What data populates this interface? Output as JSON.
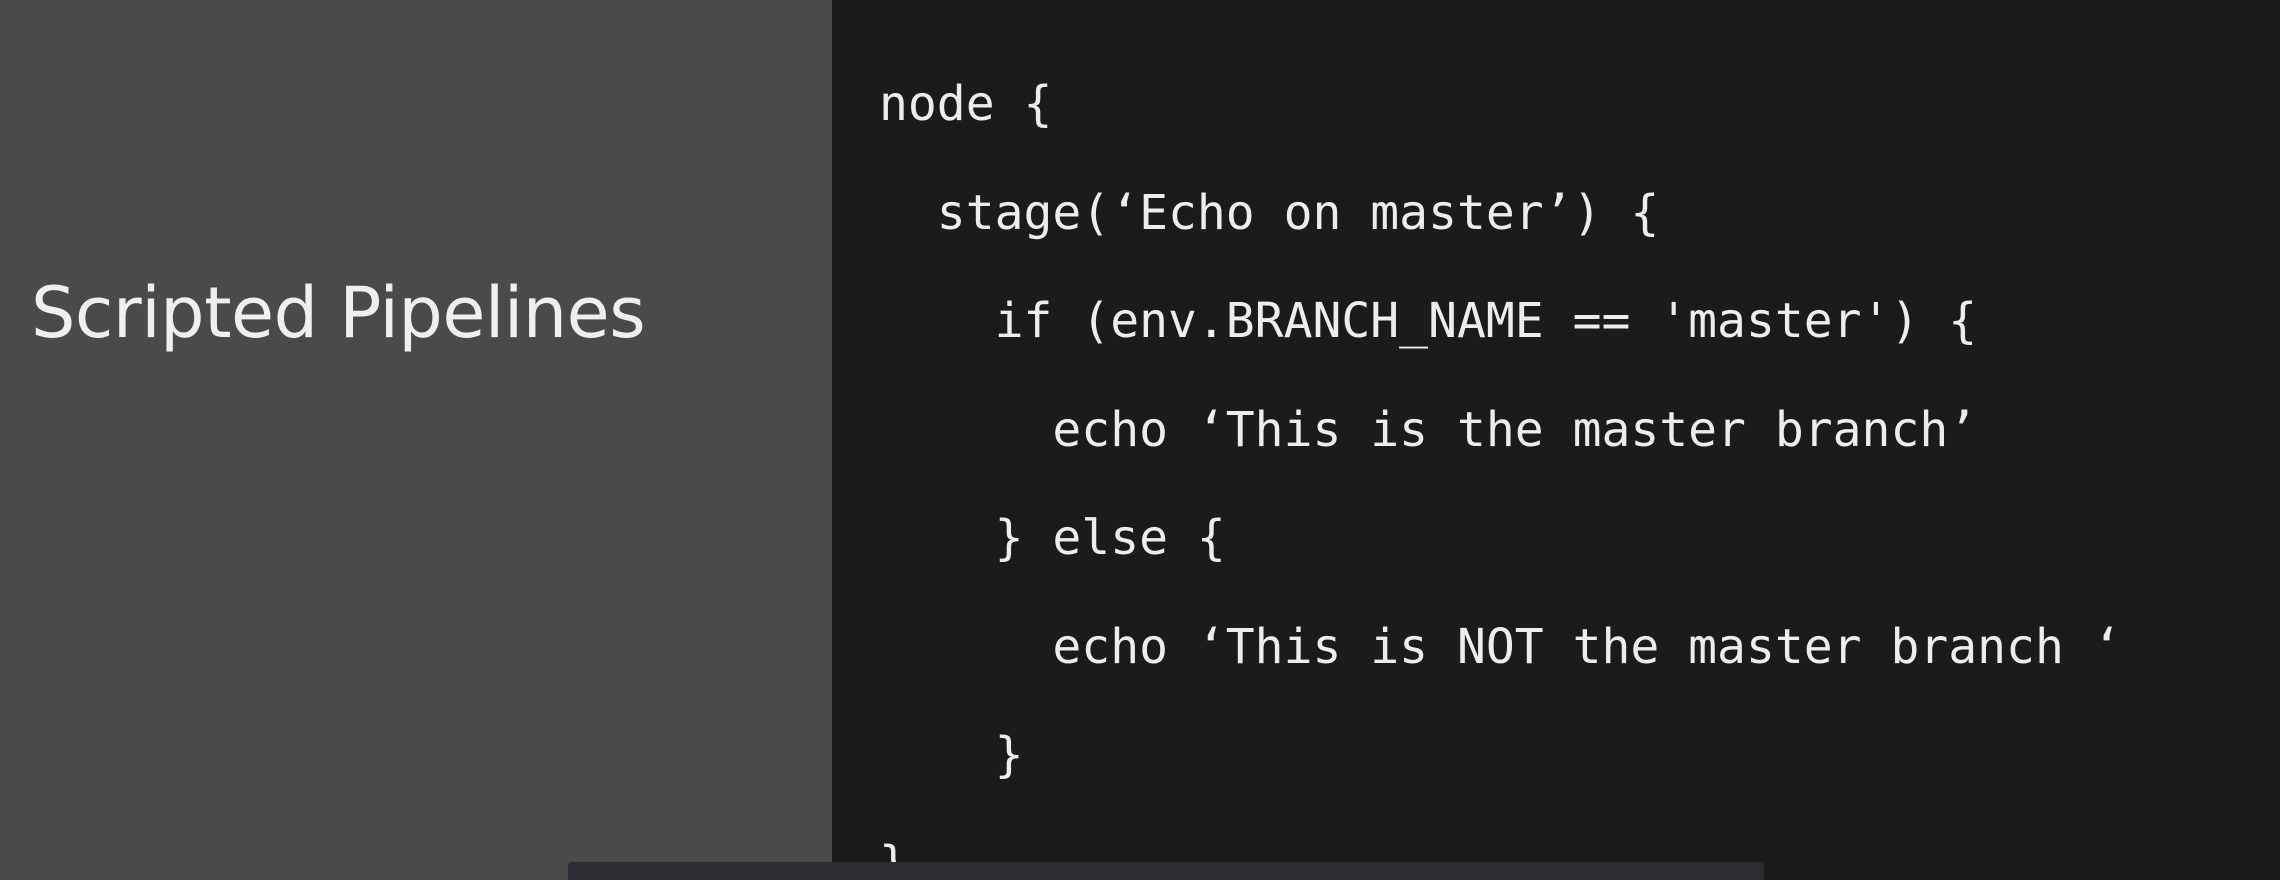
{
  "slide": {
    "title": "Scripted Pipelines"
  },
  "code": {
    "lines": [
      "node {",
      "  stage(‘Echo on master’) {",
      "    if (env.BRANCH_NAME == 'master') {",
      "      echo ‘This is the master branch’",
      "    } else {",
      "      echo ‘This is NOT the master branch ‘",
      "    }",
      "}"
    ]
  },
  "colors": {
    "left_panel_background": "#4a4a4a",
    "code_panel_background": "#1b1b1b",
    "title_text": "#efefef",
    "code_text": "#ededed",
    "bottom_bar": "#2a2c31"
  }
}
